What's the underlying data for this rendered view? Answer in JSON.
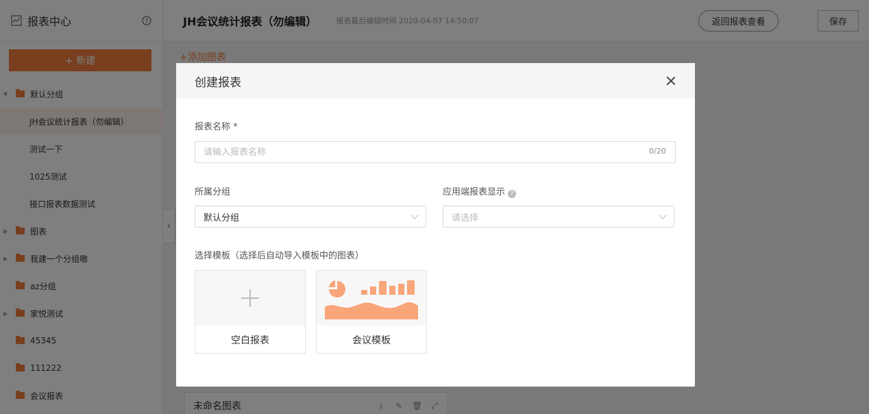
{
  "sidebar": {
    "title": "报表中心",
    "new_label": "+ 新建",
    "items": [
      {
        "label": "默认分组",
        "type": "group",
        "caret": "▼"
      },
      {
        "label": "JH会议统计报表（勿编辑）",
        "type": "leaf",
        "active": true
      },
      {
        "label": "测试一下",
        "type": "leaf"
      },
      {
        "label": "1025测试",
        "type": "leaf"
      },
      {
        "label": "接口报表数据测试",
        "type": "leaf"
      },
      {
        "label": "图表",
        "type": "group",
        "caret": "▶"
      },
      {
        "label": "我建一个分组嗷",
        "type": "group",
        "caret": "▶"
      },
      {
        "label": "az分组",
        "type": "group",
        "caret": ""
      },
      {
        "label": "家悦测试",
        "type": "group",
        "caret": "▶"
      },
      {
        "label": "45345",
        "type": "group",
        "caret": ""
      },
      {
        "label": "111222",
        "type": "group",
        "caret": ""
      },
      {
        "label": "会议报表",
        "type": "group",
        "caret": ""
      }
    ]
  },
  "topbar": {
    "title": "JH会议统计报表（勿编辑）",
    "edit_time": "报表最后编辑时间 2020-04-07 14:50:07",
    "back_label": "返回报表查看",
    "save_label": "保存"
  },
  "canvas": {
    "add_chart_label": "+添加图表",
    "card_name": "未命名图表"
  },
  "modal": {
    "title": "创建报表",
    "name_label": "报表名称 *",
    "name_placeholder": "请输入报表名称",
    "name_counter": "0/20",
    "group_label": "所属分组",
    "group_value": "默认分组",
    "app_display_label": "应用端报表显示",
    "app_display_placeholder": "请选择",
    "template_label": "选择模板（选择后自动导入模板中的图表）",
    "templates": [
      {
        "label": "空白报表"
      },
      {
        "label": "会议模板"
      }
    ]
  },
  "colors": {
    "accent": "#f07c3c",
    "template_preview": "#f9a57a"
  }
}
